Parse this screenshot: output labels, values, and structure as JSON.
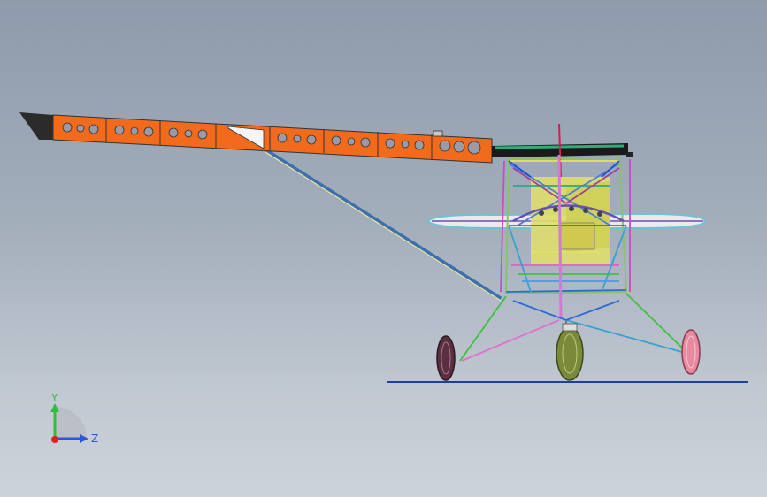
{
  "viewport": {
    "background_top": "#8e9bac",
    "background_bottom": "#cdd3da"
  },
  "model": {
    "wing_color": "#f26b1d",
    "wing_hole_color": "#9a9aa8",
    "fuselage_yellow": "#dede6e",
    "strut_blue": "#3d6fb0",
    "ground_line_color": "#1f3f9c",
    "tire_main_color": "#7a8a3a",
    "tire_left_color": "#5a3040",
    "tire_right_color": "#e58aa0"
  },
  "triad": {
    "y_label": "Y",
    "z_label": "Z",
    "y_color": "#2fbf3a",
    "z_color": "#2a57d6",
    "origin_color": "#e02020"
  }
}
